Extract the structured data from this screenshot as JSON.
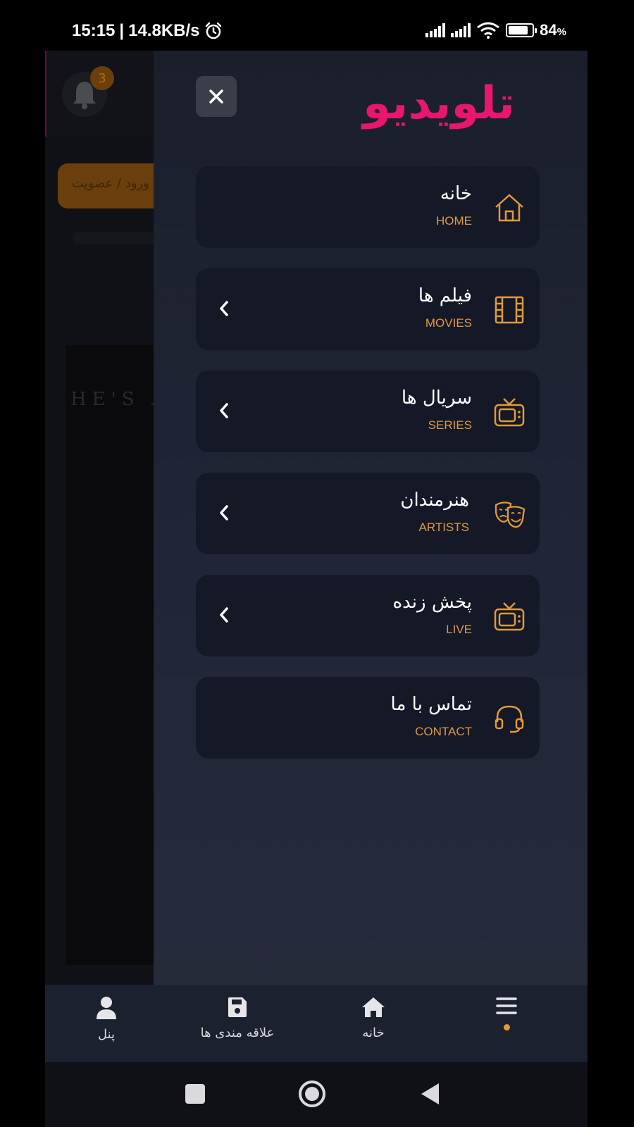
{
  "status_bar": {
    "time": "15:15",
    "separator": "|",
    "network_speed": "14.8KB/s",
    "battery_percent": "84",
    "battery_unit": "%",
    "battery_level": 0.84,
    "icons": [
      "alarm-icon",
      "signal-icon",
      "signal-icon",
      "wifi-icon",
      "battery-icon"
    ]
  },
  "background_app": {
    "notification_count": "3",
    "login_label": "ورود / عضویت",
    "poster_text": "HE'S A"
  },
  "drawer": {
    "logo_text": "تلویدیو",
    "brand_color": "#e8166f",
    "accent_color": "#e09a3c",
    "menu": [
      {
        "label": "خانه",
        "sublabel": "HOME",
        "icon": "home-icon",
        "has_submenu": false
      },
      {
        "label": "فیلم ها",
        "sublabel": "MOVIES",
        "icon": "film-icon",
        "has_submenu": true
      },
      {
        "label": "سریال ها",
        "sublabel": "SERIES",
        "icon": "tv-icon",
        "has_submenu": true
      },
      {
        "label": "هنرمندان",
        "sublabel": "ARTISTS",
        "icon": "theater-masks-icon",
        "has_submenu": true
      },
      {
        "label": "پخش زنده",
        "sublabel": "LIVE",
        "icon": "tv-icon",
        "has_submenu": true
      },
      {
        "label": "تماس با ما",
        "sublabel": "CONTACT",
        "icon": "headset-icon",
        "has_submenu": false
      }
    ]
  },
  "bottom_nav": {
    "items": [
      {
        "label": "پنل",
        "icon": "user-icon"
      },
      {
        "label": "علاقه مندی ها",
        "icon": "save-icon"
      },
      {
        "label": "خانه",
        "icon": "home-icon"
      },
      {
        "label": "",
        "icon": "menu-icon",
        "active": true
      }
    ]
  },
  "system_nav": {
    "buttons": [
      "recents-button",
      "home-button",
      "back-button"
    ]
  }
}
